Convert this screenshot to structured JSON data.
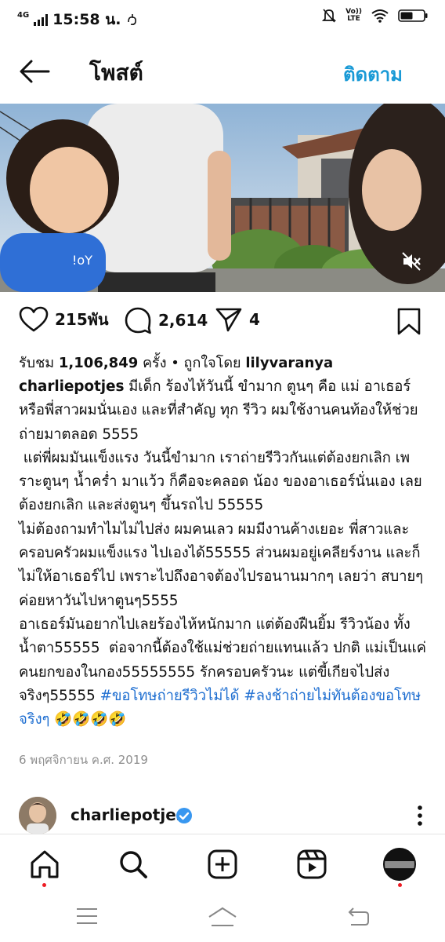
{
  "status_bar": {
    "network": "4G",
    "time": "15:58 น.",
    "volte_top": "Vo))",
    "volte_bottom": "LTE"
  },
  "header": {
    "title": "โพสต์",
    "follow_label": "ติดตาม"
  },
  "actions": {
    "likes": "215พัน",
    "comments": "2,614",
    "shares": "4"
  },
  "views": {
    "prefix": "รับชม ",
    "count": "1,106,849",
    "middle": " ครั้ง • ถูกใจโดย ",
    "liked_by": "lilyvaranya"
  },
  "caption": {
    "username": "charliepotjes",
    "body": " มีเด็ก ร้องไห้วันนี้ ขำมาก ตูนๆ คือ แม่ อาเธอร์ หรือพี่สาวผมนั่นเอง และที่สำคัญ ทุก รีวิว ผมใช้งานคนท้องให้ช่วยถ่ายมาตลอด 5555\n แต่พี่ผมมันแข็งแรง วันนี้ขำมาก เราถ่ายรีวิวกันแต่ต้องยกเลิก เพราะตูนๆ น้ำคร่ำ มาแว้ว ก็คือจะคลอด น้อง ของอาเธอร์นั่นเอง เลยต้องยกเลิก และส่งตูนๆ ขึ้นรถไป 55555\nไม่ต้องถามทำไมไม่ไปส่ง ผมคนเลว ผมมีงานค้างเยอะ พี่สาวและครอบครัวผมแข็งแรง ไปเองได้55555 ส่วนผมอยู่เคลียร์งาน และก็ไม่ให้อาเธอร์ไป เพราะไปถึงอาจต้องไปรอนานมากๆ เลยว่า สบายๆ ค่อยหาวันไปหาตูนๆ5555\nอาเธอร์มันอยากไปเลยร้องไห้หนักมาก แต่ต้องฝืนยิ้ม รีวิวน้อง ทั้งน้ำตา55555  ต่อจากนี้ต้องใช้แม่ช่วยถ่ายแทนแล้ว ปกติ แม่เป็นแค่คนยกของในกอง55555555 รักครอบครัวนะ แต่ขี้เกียจไปส่งจริงๆ55555 ",
    "hashtag_1": "#ขอโทษถ่ายรีวิวไม่ได้",
    "hashtag_2": "#ลงช้าถ่ายไม่ทันต้องขอโทษจริงๆ",
    "emojis": " 🤣🤣🤣🤣"
  },
  "post_date": "6 พฤศจิกายน ค.ศ. 2019",
  "comment_preview": {
    "username": "charliepotjes"
  },
  "colors": {
    "accent": "#1a9ad6",
    "hashtag": "#1f6fd1",
    "verified": "#3897f0",
    "notification_dot": "#ed1c24"
  },
  "icons": [
    "back-arrow-icon",
    "heart-icon",
    "comment-icon",
    "share-icon",
    "bookmark-icon",
    "mute-icon",
    "verified-icon",
    "more-icon",
    "home-icon",
    "search-icon",
    "create-icon",
    "reels-icon",
    "profile-icon",
    "menu-icon",
    "system-home-icon",
    "system-back-icon"
  ]
}
